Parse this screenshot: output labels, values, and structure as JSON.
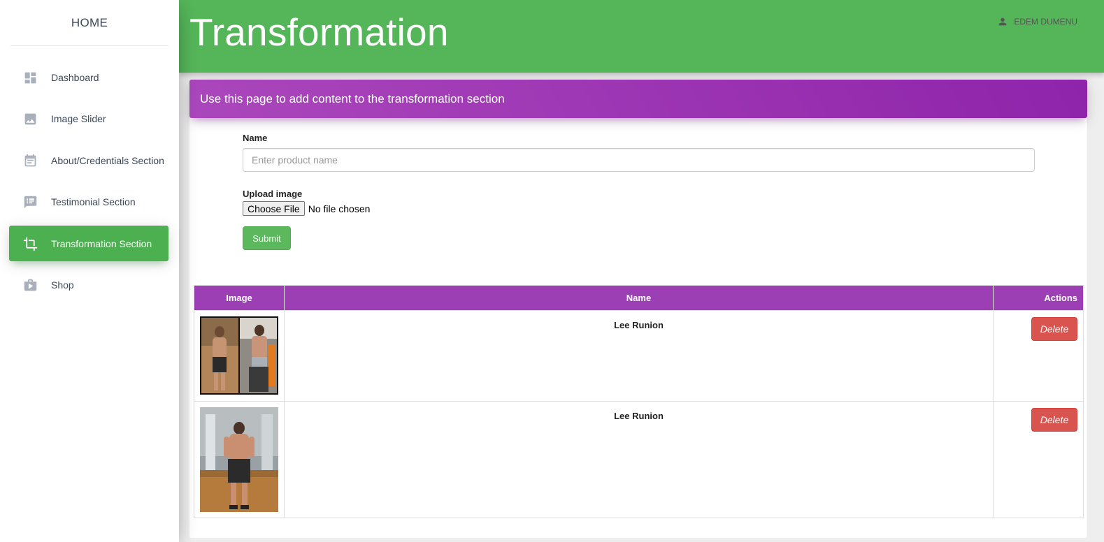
{
  "sidebar": {
    "brand": "HOME",
    "items": [
      {
        "label": "Dashboard",
        "icon": "dashboard-icon",
        "active": false
      },
      {
        "label": "Image Slider",
        "icon": "image-icon",
        "active": false
      },
      {
        "label": "About/Credentials Section",
        "icon": "event-note-icon",
        "active": false
      },
      {
        "label": "Testimonial Section",
        "icon": "chat-list-icon",
        "active": false
      },
      {
        "label": "Transformation Section",
        "icon": "crop-icon",
        "active": true
      },
      {
        "label": "Shop",
        "icon": "shop-icon",
        "active": false
      }
    ]
  },
  "header": {
    "title": "Transformation",
    "user_name": "EDEM DUMENU",
    "accent_color": "#55b559"
  },
  "banner": {
    "text": "Use this page to add content to the transformation section",
    "color": "#9c27b0"
  },
  "form": {
    "name_label": "Name",
    "name_placeholder": "Enter product name",
    "name_value": "",
    "upload_label": "Upload image",
    "choose_file_label": "Choose File",
    "file_status": "No file chosen",
    "submit_label": "Submit"
  },
  "table": {
    "columns": [
      "Image",
      "Name",
      "Actions"
    ],
    "rows": [
      {
        "name": "Lee Runion",
        "image": "before-after-photo",
        "action_label": "Delete"
      },
      {
        "name": "Lee Runion",
        "image": "gym-photo",
        "action_label": "Delete"
      }
    ]
  }
}
